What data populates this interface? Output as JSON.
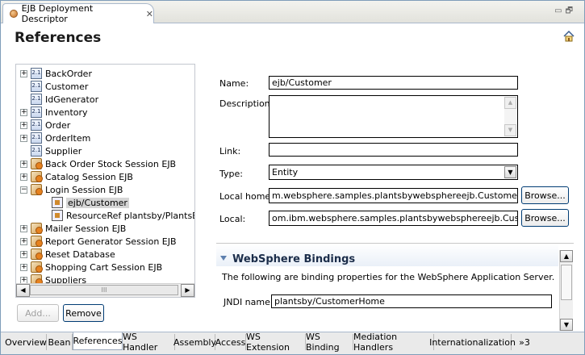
{
  "editor_tab": {
    "title": "EJB Deployment Descriptor",
    "close": "✕"
  },
  "window_controls": {
    "minimize": "▭",
    "maximize": "🗗"
  },
  "page_title": "References",
  "tree": {
    "items": [
      {
        "label": "BackOrder",
        "type": "entity",
        "expandable": true,
        "indent": 0
      },
      {
        "label": "Customer",
        "type": "entity",
        "expandable": false,
        "indent": 0
      },
      {
        "label": "IdGenerator",
        "type": "entity",
        "expandable": false,
        "indent": 0
      },
      {
        "label": "Inventory",
        "type": "entity",
        "expandable": true,
        "indent": 0
      },
      {
        "label": "Order",
        "type": "entity",
        "expandable": true,
        "indent": 0
      },
      {
        "label": "OrderItem",
        "type": "entity",
        "expandable": true,
        "indent": 0
      },
      {
        "label": "Supplier",
        "type": "entity",
        "expandable": false,
        "indent": 0
      },
      {
        "label": "Back Order Stock Session EJB",
        "type": "session",
        "expandable": true,
        "indent": 0
      },
      {
        "label": "Catalog Session EJB",
        "type": "session",
        "expandable": true,
        "indent": 0
      },
      {
        "label": "Login Session EJB",
        "type": "session",
        "expandable": true,
        "expanded": true,
        "indent": 0
      },
      {
        "label": "ejb/Customer",
        "type": "ref",
        "expandable": false,
        "indent": 1,
        "selected": true
      },
      {
        "label": "ResourceRef plantsby/PlantsByW",
        "type": "resref",
        "expandable": false,
        "indent": 1
      },
      {
        "label": "Mailer Session EJB",
        "type": "session",
        "expandable": true,
        "indent": 0
      },
      {
        "label": "Report Generator Session EJB",
        "type": "session",
        "expandable": true,
        "indent": 0
      },
      {
        "label": "Reset Database",
        "type": "session",
        "expandable": true,
        "indent": 0
      },
      {
        "label": "Shopping Cart Session EJB",
        "type": "session",
        "expandable": true,
        "indent": 0
      },
      {
        "label": "Suppliers",
        "type": "session",
        "expandable": true,
        "indent": 0
      }
    ],
    "jar_badge": "2.1",
    "scroll_grip": "III"
  },
  "buttons": {
    "add": "Add...",
    "remove": "Remove",
    "browse": "Browse..."
  },
  "form": {
    "name_label": "Name:",
    "name_value": "ejb/Customer",
    "description_label": "Description:",
    "description_value": "",
    "link_label": "Link:",
    "link_value": "",
    "type_label": "Type:",
    "type_value": "Entity",
    "local_home_label": "Local home:",
    "local_home_value": "m.websphere.samples.plantsbywebsphereejb.CustomerHome",
    "local_label": "Local:",
    "local_value": "om.ibm.websphere.samples.plantsbywebsphereejb.Customer"
  },
  "websphere": {
    "title": "WebSphere Bindings",
    "description": "The following are binding properties for the WebSphere Application Server.",
    "jndi_label": "JNDI name:",
    "jndi_value": "plantsby/CustomerHome"
  },
  "page_tabs": [
    "Overview",
    "Bean",
    "References",
    "WS Handler",
    "Assembly",
    "Access",
    "WS Extension",
    "WS Binding",
    "Mediation Handlers",
    "Internationalization"
  ],
  "page_tabs_overflow": "»3",
  "active_tab": "References"
}
